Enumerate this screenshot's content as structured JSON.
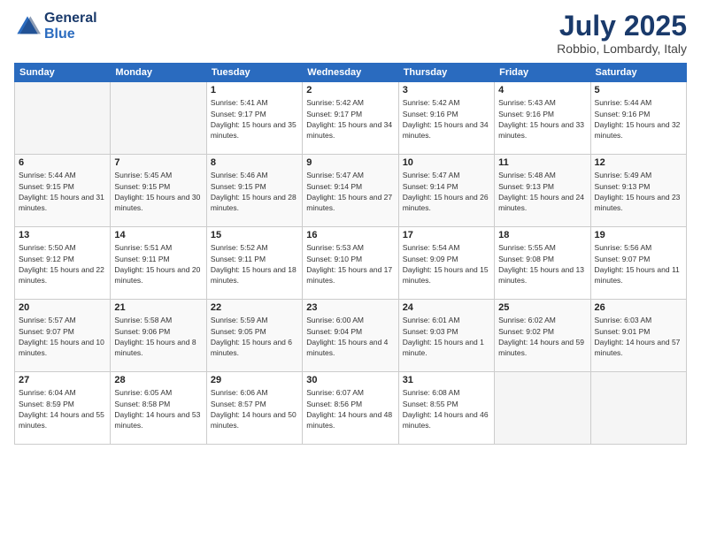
{
  "header": {
    "logo_line1": "General",
    "logo_line2": "Blue",
    "month": "July 2025",
    "location": "Robbio, Lombardy, Italy"
  },
  "weekdays": [
    "Sunday",
    "Monday",
    "Tuesday",
    "Wednesday",
    "Thursday",
    "Friday",
    "Saturday"
  ],
  "weeks": [
    [
      {
        "day": "",
        "empty": true
      },
      {
        "day": "",
        "empty": true
      },
      {
        "day": "1",
        "sunrise": "5:41 AM",
        "sunset": "9:17 PM",
        "daylight": "15 hours and 35 minutes."
      },
      {
        "day": "2",
        "sunrise": "5:42 AM",
        "sunset": "9:17 PM",
        "daylight": "15 hours and 34 minutes."
      },
      {
        "day": "3",
        "sunrise": "5:42 AM",
        "sunset": "9:16 PM",
        "daylight": "15 hours and 34 minutes."
      },
      {
        "day": "4",
        "sunrise": "5:43 AM",
        "sunset": "9:16 PM",
        "daylight": "15 hours and 33 minutes."
      },
      {
        "day": "5",
        "sunrise": "5:44 AM",
        "sunset": "9:16 PM",
        "daylight": "15 hours and 32 minutes."
      }
    ],
    [
      {
        "day": "6",
        "sunrise": "5:44 AM",
        "sunset": "9:15 PM",
        "daylight": "15 hours and 31 minutes."
      },
      {
        "day": "7",
        "sunrise": "5:45 AM",
        "sunset": "9:15 PM",
        "daylight": "15 hours and 30 minutes."
      },
      {
        "day": "8",
        "sunrise": "5:46 AM",
        "sunset": "9:15 PM",
        "daylight": "15 hours and 28 minutes."
      },
      {
        "day": "9",
        "sunrise": "5:47 AM",
        "sunset": "9:14 PM",
        "daylight": "15 hours and 27 minutes."
      },
      {
        "day": "10",
        "sunrise": "5:47 AM",
        "sunset": "9:14 PM",
        "daylight": "15 hours and 26 minutes."
      },
      {
        "day": "11",
        "sunrise": "5:48 AM",
        "sunset": "9:13 PM",
        "daylight": "15 hours and 24 minutes."
      },
      {
        "day": "12",
        "sunrise": "5:49 AM",
        "sunset": "9:13 PM",
        "daylight": "15 hours and 23 minutes."
      }
    ],
    [
      {
        "day": "13",
        "sunrise": "5:50 AM",
        "sunset": "9:12 PM",
        "daylight": "15 hours and 22 minutes."
      },
      {
        "day": "14",
        "sunrise": "5:51 AM",
        "sunset": "9:11 PM",
        "daylight": "15 hours and 20 minutes."
      },
      {
        "day": "15",
        "sunrise": "5:52 AM",
        "sunset": "9:11 PM",
        "daylight": "15 hours and 18 minutes."
      },
      {
        "day": "16",
        "sunrise": "5:53 AM",
        "sunset": "9:10 PM",
        "daylight": "15 hours and 17 minutes."
      },
      {
        "day": "17",
        "sunrise": "5:54 AM",
        "sunset": "9:09 PM",
        "daylight": "15 hours and 15 minutes."
      },
      {
        "day": "18",
        "sunrise": "5:55 AM",
        "sunset": "9:08 PM",
        "daylight": "15 hours and 13 minutes."
      },
      {
        "day": "19",
        "sunrise": "5:56 AM",
        "sunset": "9:07 PM",
        "daylight": "15 hours and 11 minutes."
      }
    ],
    [
      {
        "day": "20",
        "sunrise": "5:57 AM",
        "sunset": "9:07 PM",
        "daylight": "15 hours and 10 minutes."
      },
      {
        "day": "21",
        "sunrise": "5:58 AM",
        "sunset": "9:06 PM",
        "daylight": "15 hours and 8 minutes."
      },
      {
        "day": "22",
        "sunrise": "5:59 AM",
        "sunset": "9:05 PM",
        "daylight": "15 hours and 6 minutes."
      },
      {
        "day": "23",
        "sunrise": "6:00 AM",
        "sunset": "9:04 PM",
        "daylight": "15 hours and 4 minutes."
      },
      {
        "day": "24",
        "sunrise": "6:01 AM",
        "sunset": "9:03 PM",
        "daylight": "15 hours and 1 minute."
      },
      {
        "day": "25",
        "sunrise": "6:02 AM",
        "sunset": "9:02 PM",
        "daylight": "14 hours and 59 minutes."
      },
      {
        "day": "26",
        "sunrise": "6:03 AM",
        "sunset": "9:01 PM",
        "daylight": "14 hours and 57 minutes."
      }
    ],
    [
      {
        "day": "27",
        "sunrise": "6:04 AM",
        "sunset": "8:59 PM",
        "daylight": "14 hours and 55 minutes."
      },
      {
        "day": "28",
        "sunrise": "6:05 AM",
        "sunset": "8:58 PM",
        "daylight": "14 hours and 53 minutes."
      },
      {
        "day": "29",
        "sunrise": "6:06 AM",
        "sunset": "8:57 PM",
        "daylight": "14 hours and 50 minutes."
      },
      {
        "day": "30",
        "sunrise": "6:07 AM",
        "sunset": "8:56 PM",
        "daylight": "14 hours and 48 minutes."
      },
      {
        "day": "31",
        "sunrise": "6:08 AM",
        "sunset": "8:55 PM",
        "daylight": "14 hours and 46 minutes."
      },
      {
        "day": "",
        "empty": true
      },
      {
        "day": "",
        "empty": true
      }
    ]
  ]
}
